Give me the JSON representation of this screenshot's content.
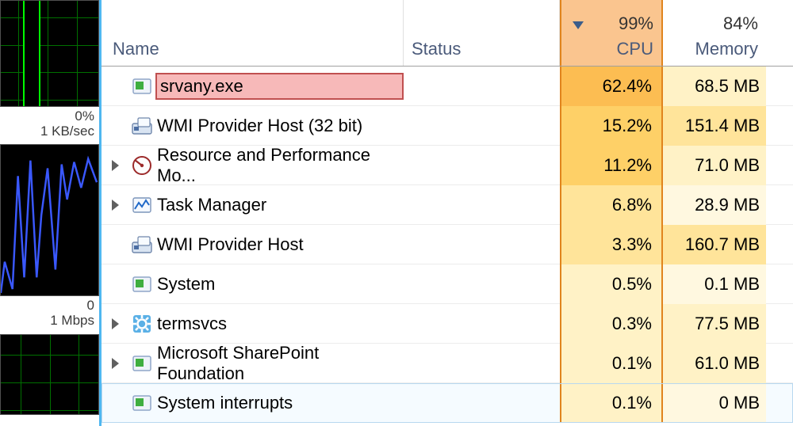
{
  "sidebar": {
    "cpu_graph_label": "0%",
    "cpu_rate_label": "1 KB/sec",
    "net_graph_label": "0",
    "net_rate_label": "1 Mbps"
  },
  "header": {
    "name": "Name",
    "status": "Status",
    "cpu_value": "99%",
    "cpu_label": "CPU",
    "mem_value": "84%",
    "mem_label": "Memory"
  },
  "rows": [
    {
      "exp": "",
      "icon": "app-icon",
      "name": "srvany.exe",
      "cpu": "62.4%",
      "cpu_heat": "heat-hh",
      "mem": "68.5 MB",
      "mem_heat": "heat-l",
      "hl": true
    },
    {
      "exp": "",
      "icon": "wmi-icon",
      "name": "WMI Provider Host (32 bit)",
      "cpu": "15.2%",
      "cpu_heat": "heat-h",
      "mem": "151.4 MB",
      "mem_heat": "heat-m"
    },
    {
      "exp": "▶",
      "icon": "perfmon-icon",
      "name": "Resource and Performance Mo...",
      "cpu": "11.2%",
      "cpu_heat": "heat-h",
      "mem": "71.0 MB",
      "mem_heat": "heat-l"
    },
    {
      "exp": "▶",
      "icon": "taskmgr-icon",
      "name": "Task Manager",
      "cpu": "6.8%",
      "cpu_heat": "heat-m",
      "mem": "28.9 MB",
      "mem_heat": "heat-xl"
    },
    {
      "exp": "",
      "icon": "wmi-icon",
      "name": "WMI Provider Host",
      "cpu": "3.3%",
      "cpu_heat": "heat-m",
      "mem": "160.7 MB",
      "mem_heat": "heat-m"
    },
    {
      "exp": "",
      "icon": "app-icon",
      "name": "System",
      "cpu": "0.5%",
      "cpu_heat": "heat-l",
      "mem": "0.1 MB",
      "mem_heat": "heat-xl"
    },
    {
      "exp": "▶",
      "icon": "gear-icon",
      "name": "termsvcs",
      "cpu": "0.3%",
      "cpu_heat": "heat-l",
      "mem": "77.5 MB",
      "mem_heat": "heat-l"
    },
    {
      "exp": "▶",
      "icon": "app-icon",
      "name": "Microsoft SharePoint Foundation",
      "cpu": "0.1%",
      "cpu_heat": "heat-l",
      "mem": "61.0 MB",
      "mem_heat": "heat-l"
    },
    {
      "exp": "",
      "icon": "app-icon",
      "name": "System interrupts",
      "cpu": "0.1%",
      "cpu_heat": "heat-l",
      "mem": "0 MB",
      "mem_heat": "heat-xl",
      "sel": true
    }
  ]
}
